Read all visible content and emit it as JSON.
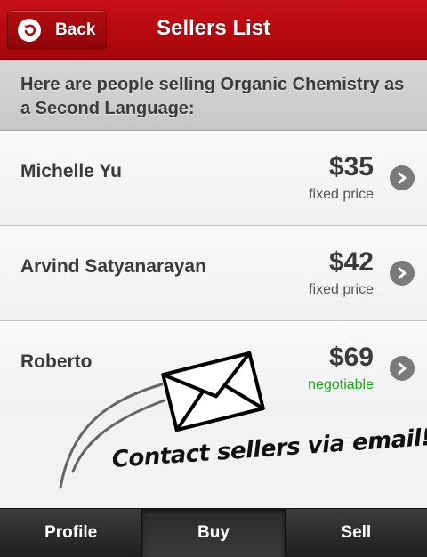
{
  "navbar": {
    "back_label": "Back",
    "title": "Sellers List",
    "color": "#b8090f"
  },
  "intro": {
    "text": "Here are people selling Organic Chemistry as a Second Language:"
  },
  "sellers": [
    {
      "name": "Michelle Yu",
      "price": "$35",
      "terms": "fixed price"
    },
    {
      "name": "Arvind Satyanarayan",
      "price": "$42",
      "terms": "fixed price"
    },
    {
      "name": "Roberto",
      "price": "$69",
      "terms": "negotiable"
    }
  ],
  "annotation": {
    "text": "Contact sellers via email!",
    "icon": "envelope-icon"
  },
  "tabs": [
    {
      "label": "Profile",
      "active": false
    },
    {
      "label": "Buy",
      "active": true
    },
    {
      "label": "Sell",
      "active": false
    }
  ],
  "colors": {
    "negotiable": "#1aa31a",
    "tabbar": "#2b2b2b"
  }
}
